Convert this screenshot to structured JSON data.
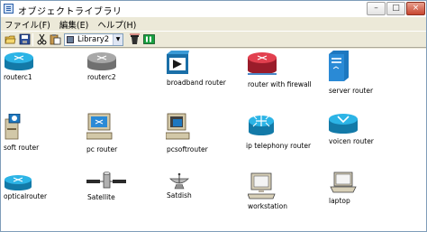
{
  "window": {
    "title": "オブジェクトライブラリ",
    "min_glyph": "–",
    "max_glyph": "□",
    "close_glyph": "×"
  },
  "menu": {
    "items": [
      {
        "label": "ファイル(F)"
      },
      {
        "label": "編集(E)"
      },
      {
        "label": "ヘルプ(H)"
      }
    ]
  },
  "toolbar": {
    "library_selected": "Library2",
    "dropdown_arrow": "▼"
  },
  "library_items": [
    {
      "label": "routerc1",
      "icon": "router-cyan-icon"
    },
    {
      "label": "routerc2",
      "icon": "router-gray-icon"
    },
    {
      "label": "broadband router",
      "icon": "broadband-router-icon"
    },
    {
      "label": "router with firewall",
      "icon": "firewall-router-icon"
    },
    {
      "label": "server router",
      "icon": "server-router-icon"
    },
    {
      "label": "soft router",
      "icon": "soft-router-icon"
    },
    {
      "label": "pc router",
      "icon": "pc-router-icon"
    },
    {
      "label": "pcsoftrouter",
      "icon": "pc-soft-router-icon"
    },
    {
      "label": "ip telephony router",
      "icon": "ip-telephony-router-icon"
    },
    {
      "label": "voicen router",
      "icon": "voice-router-icon"
    },
    {
      "label": "opticalrouter",
      "icon": "optical-router-icon"
    },
    {
      "label": "Satellite",
      "icon": "satellite-icon"
    },
    {
      "label": "Satdish",
      "icon": "satellite-dish-icon"
    },
    {
      "label": "workstation",
      "icon": "workstation-icon"
    },
    {
      "label": "laptop",
      "icon": "laptop-icon"
    }
  ],
  "colors": {
    "router_cyan": "#1e9fd0",
    "router_gray": "#8c8c8c",
    "router_red": "#c8283a",
    "device_blue": "#1f78b4",
    "titlebar_bg": "#ffffff",
    "window_bg": "#ece9d8"
  }
}
